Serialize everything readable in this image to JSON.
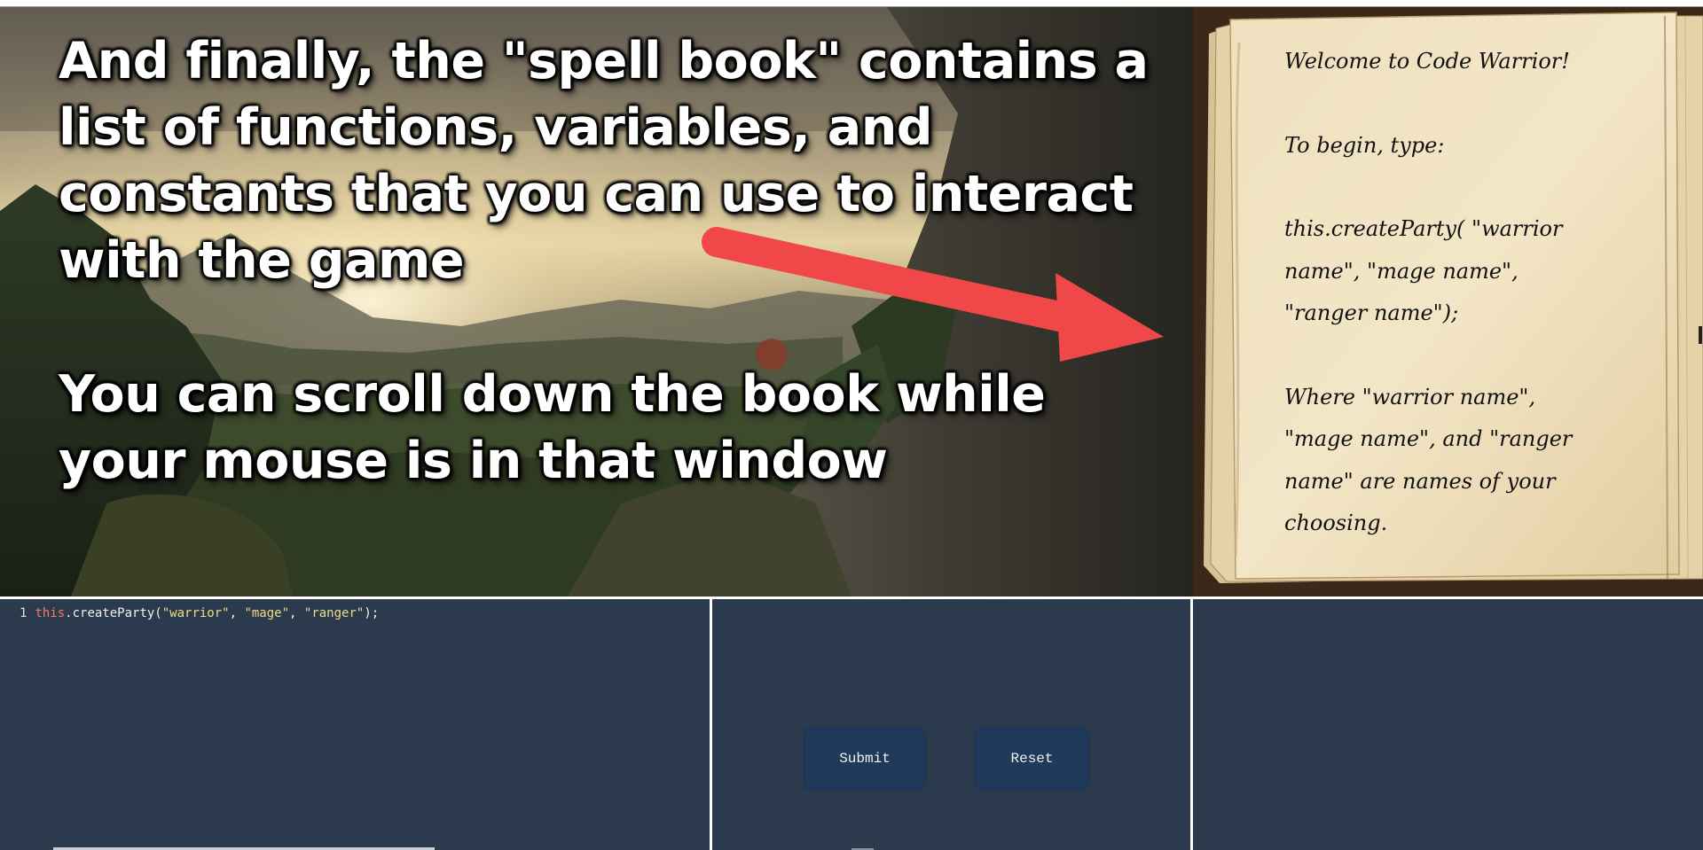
{
  "tutorial": {
    "paragraph_1": "And finally, the \"spell book\" contains a list of functions, variables, and constants that you can use to interact with the game",
    "paragraph_2": "You can scroll down the book while your mouse is in that window"
  },
  "spell_book": {
    "line_1": "Welcome to Code Warrior!",
    "line_2": "To begin, type:",
    "line_3": "this.createParty( \"warrior name\", \"mage name\", \"ranger name\");",
    "line_4": "Where \"warrior name\", \"mage name\", and \"ranger name\" are names of your choosing."
  },
  "editor": {
    "line_number": "1",
    "keyword": "this",
    "call": ".createParty(",
    "arg_1": "\"warrior\"",
    "sep_1": ", ",
    "arg_2": "\"mage\"",
    "sep_2": ", ",
    "arg_3": "\"ranger\"",
    "end": ");"
  },
  "controls": {
    "submit_label": "Submit",
    "reset_label": "Reset"
  },
  "icons": {
    "arrow": "right-arrow-icon"
  },
  "colors": {
    "panel_bg": "#2b3a4c",
    "button_bg": "#1f3a5a",
    "arrow": "#f04848",
    "code_keyword": "#f27a6a",
    "code_string": "#eedd88"
  }
}
